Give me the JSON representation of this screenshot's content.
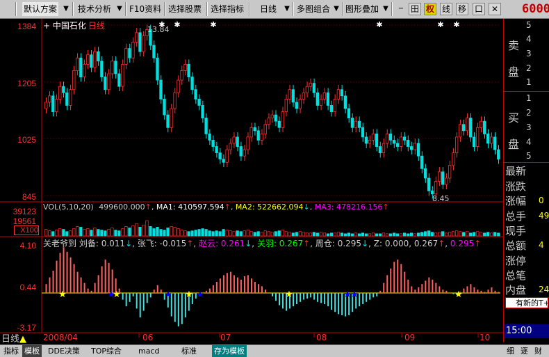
{
  "toolbar": {
    "items": [
      "默认方案",
      "技术分析",
      "F10资料",
      "选择股票",
      "选择指标",
      "日线",
      "多图组合",
      "图形叠加"
    ],
    "icons": [
      "田",
      "权",
      "线",
      "移",
      "口"
    ],
    "price": "6000"
  },
  "chart": {
    "title": "中国石化",
    "period": "日线",
    "y_labels": [
      "1384",
      "1205",
      "1025",
      "845"
    ],
    "high_label": "13.84",
    "low_label": "8.45",
    "vol_labels": [
      "39123",
      "19561",
      "X100"
    ],
    "vol_legend": {
      "name": "VOL(5,10,20)",
      "value": "499600.000",
      "ma1": "MA1: 410597.594",
      "ma2": "MA2: 522662.094",
      "ma3": "MA3: 478216.156"
    },
    "ind_labels": [
      "4.10",
      "0.44",
      "-3.17"
    ],
    "ind_legend": {
      "name": "关老爷到",
      "liubei": "刘备: 0.011",
      "zhangfei": "张飞: -0.015",
      "zhaoyun": "赵云: 0.261",
      "guanyu": "关羽: 0.267",
      "zhoucang": "周仓: 0.295",
      "z": "Z: 0.000,",
      "z2": "0.267",
      "z3": "0.295"
    },
    "x_labels": [
      "2008/04",
      "06",
      "07",
      "08",
      "09",
      "10"
    ],
    "arrows": [
      "↓",
      "↑",
      "↓",
      "↑",
      "↓",
      "↑",
      "↓",
      "↑",
      "↓"
    ]
  },
  "side": {
    "sell": "卖盘",
    "buy": "买盘",
    "levels_sell": [
      "5",
      "4",
      "3",
      "2",
      "1"
    ],
    "levels_buy": [
      "1",
      "2",
      "3",
      "4",
      "5"
    ],
    "rows": [
      {
        "label": "最新",
        "value": ""
      },
      {
        "label": "涨跌",
        "value": ""
      },
      {
        "label": "涨幅",
        "value": "0"
      },
      {
        "label": "总手",
        "value": "49"
      },
      {
        "label": "现手",
        "value": ""
      },
      {
        "label": "总额",
        "value": "4"
      },
      {
        "label": "涨停",
        "value": ""
      },
      {
        "label": "总笔",
        "value": ""
      },
      {
        "label": "内盘",
        "value": "24"
      }
    ],
    "new_notice": "有新的T+",
    "time": "15:00",
    "day_label": "日线"
  },
  "bottom": {
    "tabs": [
      "指标",
      "模板",
      "DDE决策",
      "TOP综合",
      "macd",
      "标准",
      "存为模板"
    ],
    "right": [
      "细",
      "逐",
      "财"
    ]
  },
  "colors": {
    "up": "#ff3030",
    "down": "#00e0e0",
    "ma1": "#ffffff",
    "ma2": "#ffff00",
    "ma3": "#ff00ff",
    "grid": "#c00000"
  },
  "chart_data": {
    "type": "candlestick",
    "ylim": [
      8.45,
      13.84
    ],
    "closes": [
      11.4,
      11.6,
      11.1,
      11.5,
      11.9,
      11.7,
      11.3,
      11.8,
      12.4,
      12.8,
      12.2,
      12.6,
      12.9,
      12.5,
      13.0,
      12.7,
      12.2,
      11.8,
      12.3,
      12.7,
      12.3,
      11.9,
      12.6,
      13.1,
      12.8,
      13.3,
      13.6,
      13.0,
      13.5,
      13.7,
      13.2,
      12.8,
      12.1,
      11.5,
      11.0,
      10.6,
      11.2,
      11.7,
      12.1,
      12.4,
      12.6,
      12.2,
      11.8,
      11.5,
      11.3,
      10.9,
      10.4,
      10.2,
      10.0,
      9.8,
      9.6,
      9.5,
      9.9,
      10.1,
      10.3,
      10.0,
      9.7,
      9.9,
      10.3,
      10.6,
      10.5,
      10.2,
      10.4,
      10.7,
      10.9,
      11.0,
      10.8,
      10.6,
      11.1,
      11.5,
      11.8,
      11.4,
      11.2,
      11.5,
      11.7,
      11.9,
      12.0,
      11.7,
      11.3,
      11.5,
      11.7,
      11.3,
      11.1,
      11.5,
      11.8,
      11.6,
      11.2,
      10.9,
      10.6,
      10.8,
      10.6,
      10.3,
      10.1,
      10.2,
      10.4,
      10.0,
      9.8,
      10.1,
      10.4,
      10.2,
      10.1,
      10.0,
      10.3,
      10.2,
      10.0,
      9.9,
      10.1,
      9.7,
      9.3,
      9.0,
      8.6,
      8.5,
      8.9,
      9.2,
      8.8,
      9.0,
      9.4,
      9.8,
      10.3,
      10.7,
      10.5,
      10.9,
      10.3,
      10.0,
      10.6,
      10.8,
      10.4,
      10.1,
      10.3,
      9.9,
      9.6
    ],
    "vols": [
      0.9,
      0.7,
      0.6,
      0.8,
      1.0,
      0.9,
      0.6,
      0.7,
      1.0,
      1.3,
      1.2,
      0.9,
      1.0,
      0.8,
      1.1,
      0.9,
      0.8,
      0.7,
      0.9,
      1.1,
      0.8,
      0.7,
      1.0,
      1.3,
      1.1,
      1.4,
      1.7,
      1.2,
      1.5,
      2.1,
      1.3,
      1.0,
      1.2,
      0.9,
      0.8,
      1.1,
      1.3,
      1.2,
      1.0,
      0.8,
      0.7,
      0.6,
      0.7,
      0.8,
      0.9,
      1.0,
      0.9,
      0.7,
      0.6,
      0.7,
      0.6,
      0.9,
      0.8,
      0.7,
      0.6,
      0.7,
      0.6,
      0.7,
      0.8,
      0.6,
      0.5,
      0.6,
      0.5,
      0.7,
      0.6,
      0.5,
      0.6,
      0.7,
      0.8,
      0.6,
      0.5,
      0.4,
      0.5,
      0.6,
      0.5,
      0.4,
      0.4,
      0.5,
      0.4,
      0.5,
      0.4,
      0.3,
      0.4,
      0.4,
      0.5,
      0.4,
      0.3,
      0.4,
      0.3,
      0.4,
      0.3,
      0.4,
      0.3,
      0.3,
      0.4,
      0.3,
      0.3,
      0.4,
      0.3,
      0.3,
      0.4,
      0.3,
      0.3,
      0.4,
      0.3,
      0.4,
      0.3,
      0.4,
      0.5,
      0.6,
      0.7,
      0.5,
      0.4,
      0.5,
      0.6,
      0.4,
      0.5,
      0.6,
      0.7,
      0.6,
      0.5,
      0.6,
      0.4,
      0.5,
      0.6,
      0.5,
      0.4,
      0.5,
      0.4,
      0.5,
      0.4
    ],
    "osc": [
      0.8,
      1.4,
      2.0,
      2.9,
      3.6,
      4.1,
      3.7,
      3.2,
      2.6,
      1.9,
      1.4,
      0.9,
      0.4,
      0.2,
      0.9,
      1.6,
      2.4,
      3.0,
      2.7,
      2.1,
      1.3,
      0.4,
      -0.6,
      -1.2,
      -0.8,
      -0.3,
      -1.4,
      -2.2,
      -1.6,
      -0.9,
      -0.4,
      0.3,
      0.7,
      0.3,
      -0.6,
      -1.3,
      -2.1,
      -2.6,
      -3.0,
      -2.8,
      -2.2,
      -1.6,
      -1.0,
      -0.5,
      -0.2,
      0.0,
      0.2,
      0.4,
      0.7,
      1.0,
      1.3,
      1.6,
      1.8,
      1.9,
      1.6,
      1.4,
      1.2,
      1.5,
      1.6,
      1.3,
      1.0,
      0.8,
      0.6,
      0.3,
      0.0,
      -0.3,
      -0.7,
      -1.1,
      -1.4,
      -1.6,
      -1.4,
      -1.2,
      -1.0,
      -0.8,
      -0.6,
      -0.5,
      -0.4,
      -0.6,
      -0.8,
      -0.9,
      -1.0,
      -1.2,
      -1.5,
      -1.7,
      -1.9,
      -2.0,
      -2.1,
      -2.0,
      -1.7,
      -1.4,
      -1.2,
      -1.0,
      -0.8,
      -0.6,
      -0.4,
      -0.3,
      0.2,
      0.9,
      1.6,
      2.2,
      2.8,
      3.0,
      2.6,
      1.9,
      1.2,
      0.6,
      0.3,
      0.5,
      0.8,
      1.1,
      1.4,
      1.2,
      0.9,
      0.6,
      0.3,
      0.2,
      0.0,
      -0.1,
      -0.2,
      0.1,
      0.4,
      0.6,
      0.8,
      0.5,
      0.3,
      0.2,
      0.1,
      0.3,
      0.5,
      0.2,
      0.1
    ],
    "x_categories": [
      "2008/04",
      "06",
      "07",
      "08",
      "09",
      "10"
    ]
  }
}
